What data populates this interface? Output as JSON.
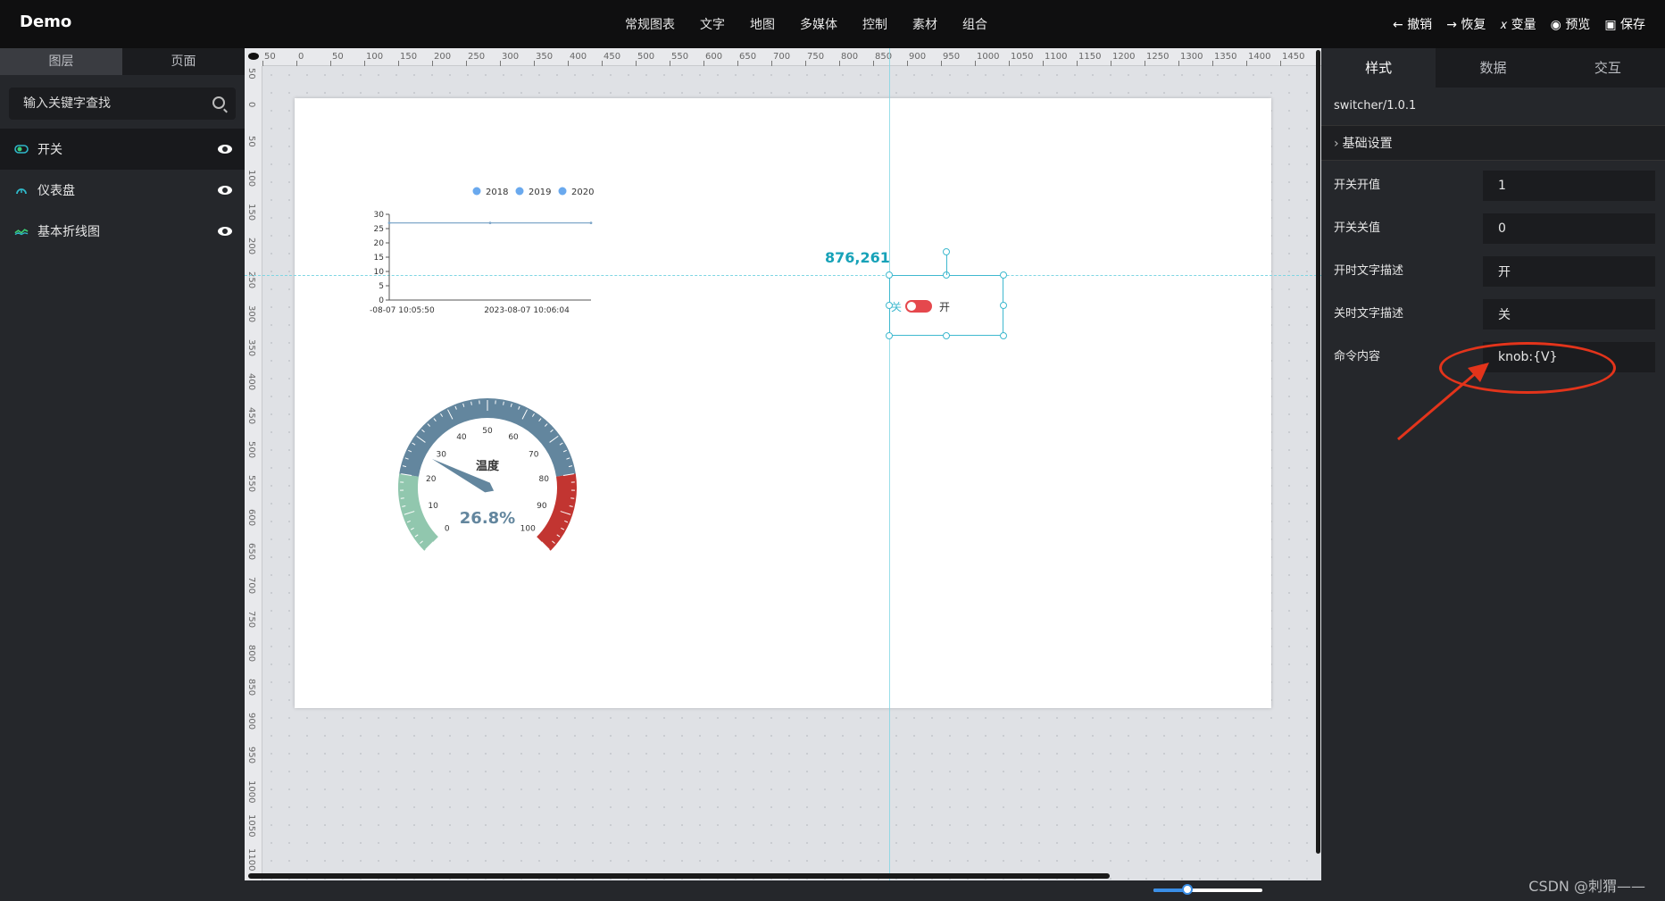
{
  "app": {
    "title": "Demo"
  },
  "menu": [
    "常规图表",
    "文字",
    "地图",
    "多媒体",
    "控制",
    "素材",
    "组合"
  ],
  "actions": [
    {
      "icon": "arrow-left-icon",
      "label": "撤销"
    },
    {
      "icon": "arrow-right-icon",
      "label": "恢复"
    },
    {
      "icon": "variable-icon",
      "label": "变量"
    },
    {
      "icon": "eye-icon",
      "label": "预览"
    },
    {
      "icon": "save-icon",
      "label": "保存"
    }
  ],
  "left_panel": {
    "tabs": [
      "图层",
      "页面"
    ],
    "search_placeholder": "输入关键字查找",
    "layers": [
      {
        "label": "开关",
        "icon": "switch-icon",
        "active": true
      },
      {
        "label": "仪表盘",
        "icon": "gauge-icon",
        "active": false
      },
      {
        "label": "基本折线图",
        "icon": "line-chart-icon",
        "active": false
      }
    ]
  },
  "rulers": {
    "top": [
      "50",
      "0",
      "50",
      "100",
      "150",
      "200",
      "250",
      "300",
      "350",
      "400",
      "450",
      "500",
      "550",
      "600",
      "650",
      "700",
      "750",
      "800",
      "850",
      "900",
      "950",
      "1000",
      "1050",
      "1100",
      "1150",
      "1200",
      "1250",
      "1300",
      "1350",
      "1400",
      "1450"
    ],
    "left": [
      "50",
      "0",
      "50",
      "100",
      "150",
      "200",
      "250",
      "300",
      "350",
      "400",
      "450",
      "500",
      "550",
      "600",
      "650",
      "700",
      "750",
      "800",
      "850",
      "900",
      "950",
      "1000",
      "1050",
      "1100"
    ]
  },
  "canvas": {
    "coordinate": "876,261",
    "switch": {
      "off_text": "关",
      "on_text": "开"
    }
  },
  "chart_data": [
    {
      "type": "line",
      "legend": [
        "2018",
        "2019",
        "2020"
      ],
      "x": [
        "-08-07 10:05:50",
        "2023-08-07 10:06:04"
      ],
      "y_ticks": [
        "0",
        "5",
        "10",
        "15",
        "20",
        "25",
        "30"
      ],
      "ylim": [
        0,
        30
      ],
      "series": [
        {
          "name": "2018",
          "values": [
            27,
            27,
            27
          ]
        }
      ],
      "legend_position": "top"
    },
    {
      "type": "gauge",
      "title": "温度",
      "value": 26.8,
      "value_label": "26.8%",
      "min": 0,
      "max": 100,
      "tick_labels": [
        "0",
        "10",
        "20",
        "30",
        "40",
        "50",
        "60",
        "70",
        "80",
        "90",
        "100"
      ]
    }
  ],
  "right_panel": {
    "tabs": [
      "样式",
      "数据",
      "交互"
    ],
    "version": "switcher/1.0.1",
    "section": "基础设置",
    "fields": [
      {
        "label": "开关开值",
        "value": "1"
      },
      {
        "label": "开关关值",
        "value": "0"
      },
      {
        "label": "开时文字描述",
        "value": "开"
      },
      {
        "label": "关时文字描述",
        "value": "关"
      },
      {
        "label": "命令内容",
        "value": "knob:{V}"
      }
    ]
  },
  "watermark": "CSDN @刺猬——"
}
